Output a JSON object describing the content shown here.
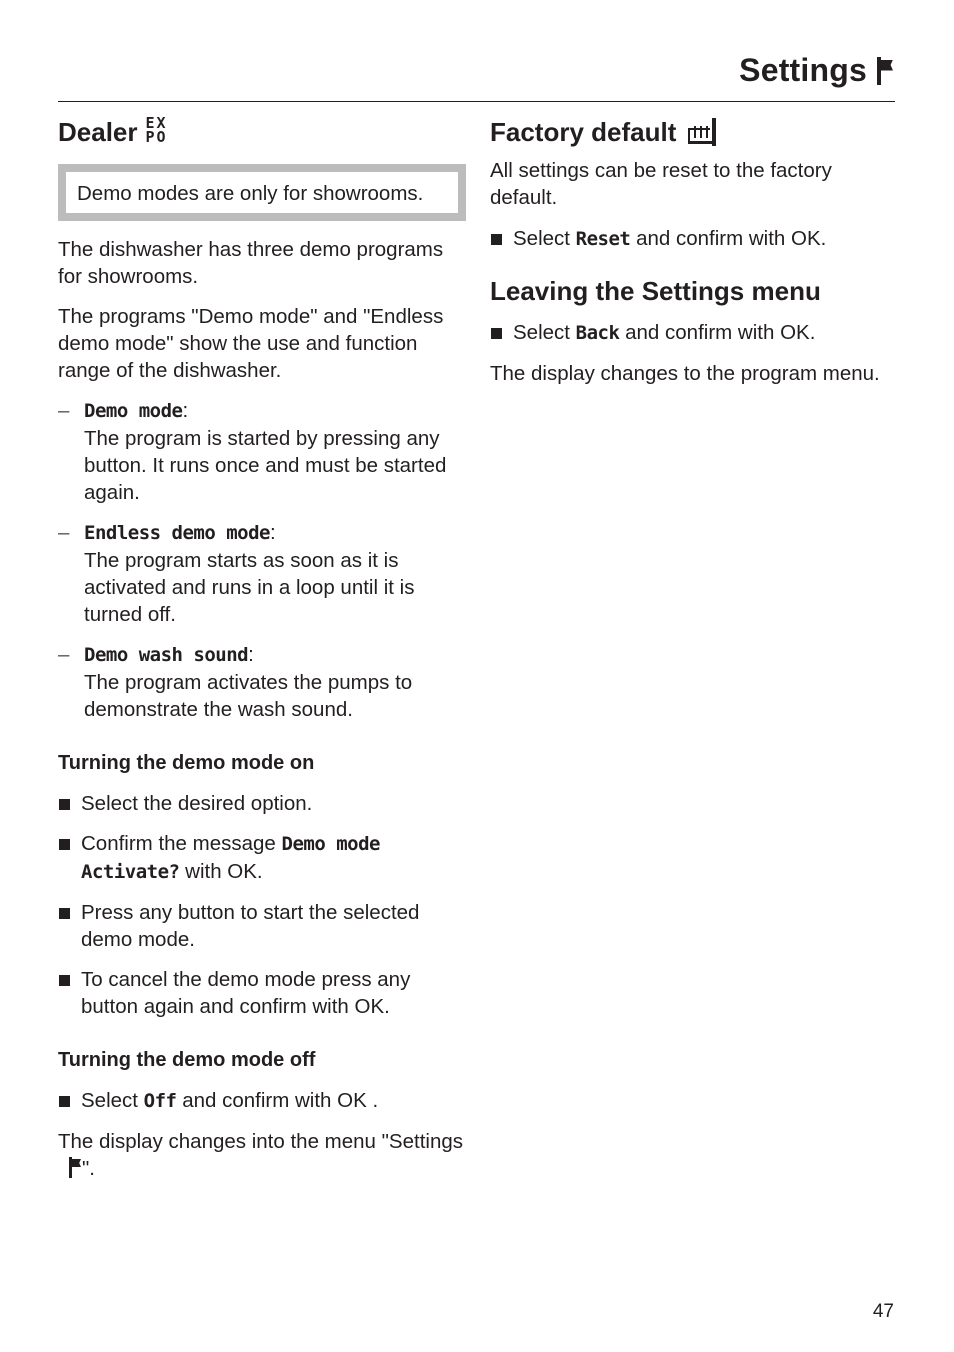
{
  "header": {
    "title": "Settings",
    "title_icon": "flag-icon"
  },
  "dealer": {
    "heading": "Dealer",
    "heading_icon": "expo-icon",
    "icon_text_top": "EX",
    "icon_text_bottom": "PO",
    "note": "Demo modes are  only for showrooms.",
    "paragraphs": [
      "The dishwasher has three demo programs for showrooms.",
      "The programs \"Demo mode\" and \"Endless demo mode\" show the use and function range of the dishwasher."
    ],
    "modes": [
      {
        "name": "Demo mode",
        "description": "The program is started by pressing any button. It runs once and must be started again."
      },
      {
        "name": "Endless demo mode",
        "description": "The program starts as soon as it is activated and runs in a loop until it is turned off."
      },
      {
        "name": "Demo wash sound",
        "description": "The program activates the pumps to demonstrate the wash sound."
      }
    ],
    "on_section": {
      "heading": "Turning the demo mode on",
      "steps": [
        {
          "text": "Select the desired option."
        },
        {
          "before": "Confirm the message ",
          "display": "Demo mode Activate?",
          "after": " with OK."
        },
        {
          "text": "Press any button to start the selected demo mode."
        },
        {
          "text": "To cancel the demo mode press any button again and confirm with OK."
        }
      ]
    },
    "off_section": {
      "heading": "Turning the demo mode off",
      "step_before": "Select ",
      "step_display": "Off",
      "step_after": " and confirm with OK .",
      "result_before": "The display changes into the menu \"Settings",
      "result_after": "\"."
    }
  },
  "factory_default": {
    "heading": "Factory default",
    "heading_icon": "factory-icon",
    "paragraph": "All settings can be reset to the factory default.",
    "step_before": "Select ",
    "step_display": "Reset",
    "step_after": " and confirm with OK."
  },
  "leaving": {
    "heading": "Leaving the Settings menu",
    "step_before": "Select ",
    "step_display": "Back",
    "step_after": " and confirm with OK.",
    "paragraph": "The display changes to the program menu."
  },
  "footer": {
    "page_number": "47"
  }
}
